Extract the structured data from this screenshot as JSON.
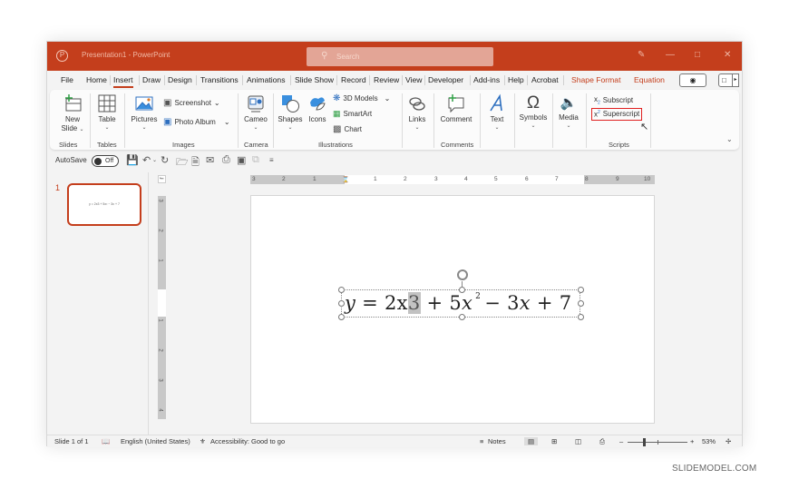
{
  "titlebar": {
    "app_title": "Presentation1  -  PowerPoint",
    "search_placeholder": "Search",
    "logo_icon": "powerpoint-logo-icon",
    "controls": [
      "pen-icon",
      "minimize-icon",
      "maximize-icon",
      "close-icon"
    ],
    "brand_color": "#c43e1c"
  },
  "tabs": [
    {
      "label": "File"
    },
    {
      "label": "Home"
    },
    {
      "label": "Insert",
      "active": true
    },
    {
      "label": "Draw"
    },
    {
      "label": "Design"
    },
    {
      "label": "Transitions"
    },
    {
      "label": "Animations"
    },
    {
      "label": "Slide Show"
    },
    {
      "label": "Record"
    },
    {
      "label": "Review"
    },
    {
      "label": "View"
    },
    {
      "label": "Developer"
    },
    {
      "label": "Add-ins"
    },
    {
      "label": "Help"
    },
    {
      "label": "Acrobat"
    },
    {
      "label": "Shape Format",
      "contextual": true
    },
    {
      "label": "Equation",
      "contextual": true
    }
  ],
  "ribbon": {
    "new_slide": "New",
    "new_slide_2": "Slide",
    "table": "Table",
    "pictures": "Pictures",
    "screenshot": "Screenshot",
    "photo_album": "Photo Album",
    "cameo": "Cameo",
    "shapes": "Shapes",
    "icons": "Icons",
    "models_3d": "3D Models",
    "smartart": "SmartArt",
    "chart": "Chart",
    "links": "Links",
    "comment": "Comment",
    "text": "Text",
    "symbols": "Symbols",
    "media": "Media",
    "subscript": "Subscript",
    "superscript": "Superscript",
    "groups": {
      "slides": "Slides",
      "tables": "Tables",
      "images": "Images",
      "camera": "Camera",
      "illustrations": "Illustrations",
      "comments": "Comments",
      "scripts": "Scripts"
    }
  },
  "qat": {
    "autosave_label": "AutoSave",
    "autosave_state": "Off"
  },
  "thumbnails": [
    {
      "number": "1",
      "text": "y = 2x3 + 5x² − 3x + 7"
    }
  ],
  "rulers": {
    "horizontal": [
      "3",
      "2",
      "1",
      "",
      "1",
      "2",
      "3",
      "4",
      "5",
      "6",
      "7",
      "8",
      "9",
      "10"
    ],
    "vertical": [
      "3",
      "2",
      "1",
      "",
      "1",
      "2",
      "3",
      "4"
    ]
  },
  "slide": {
    "equation": {
      "y": "y",
      "eq": " = 2x",
      "selected": "3",
      "mid": " + 5",
      "x1": "x",
      "exp": "2",
      "rest1": "− 3",
      "x2": "x",
      "rest2": " + 7"
    }
  },
  "statusbar": {
    "slide_info": "Slide 1 of 1",
    "language": "English (United States)",
    "accessibility": "Accessibility: Good to go",
    "notes": "Notes",
    "zoom_level": "53%",
    "zoom_fraction": 0.53
  },
  "watermark": "SLIDEMODEL.COM"
}
